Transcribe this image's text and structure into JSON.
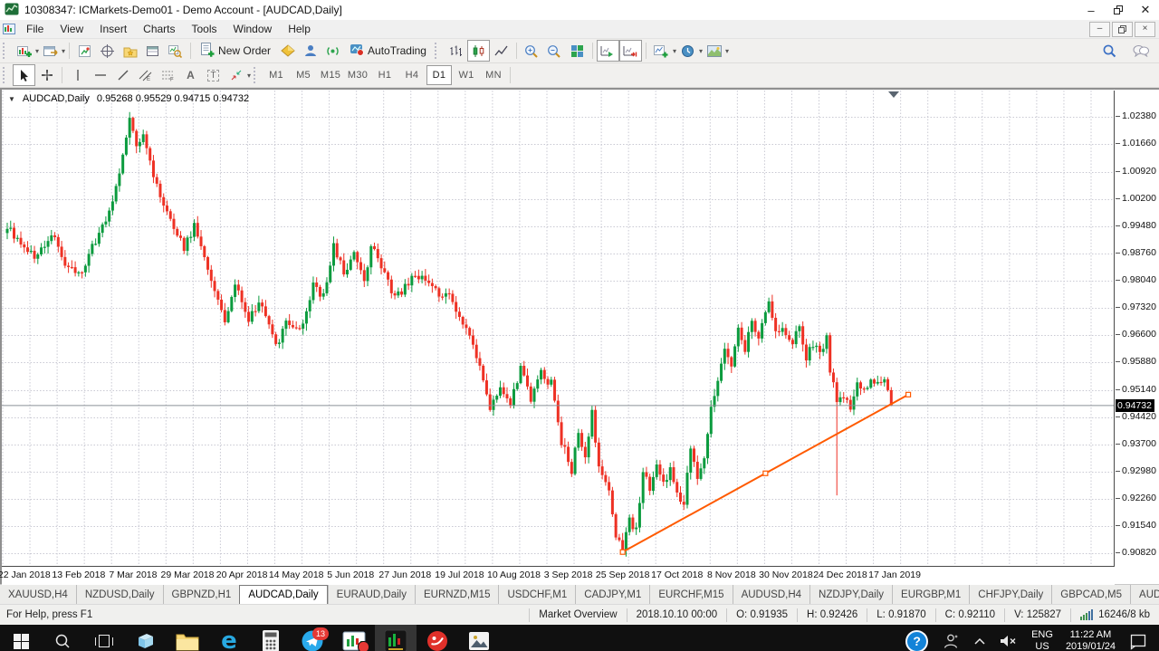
{
  "window": {
    "title": "10308347: ICMarkets-Demo01 - Demo Account - [AUDCAD,Daily]"
  },
  "menu": {
    "items": [
      "File",
      "View",
      "Insert",
      "Charts",
      "Tools",
      "Window",
      "Help"
    ]
  },
  "toolbar": {
    "new_order_label": "New Order",
    "autotrading_label": "AutoTrading",
    "timeframes": [
      "M1",
      "M5",
      "M15",
      "M30",
      "H1",
      "H4",
      "D1",
      "W1",
      "MN"
    ],
    "active_timeframe": "D1"
  },
  "chart": {
    "symbol_label": "AUDCAD,Daily",
    "ohlc_text": "0.95268 0.95529 0.94715 0.94732",
    "current_price": "0.94732",
    "price_axis_labels": [
      "1.02380",
      "1.01660",
      "1.00920",
      "1.00200",
      "0.99480",
      "0.98760",
      "0.98040",
      "0.97320",
      "0.96600",
      "0.95880",
      "0.95140",
      "0.94420",
      "0.93700",
      "0.92980",
      "0.92260",
      "0.91540",
      "0.90820"
    ],
    "date_axis_labels": [
      "22 Jan 2018",
      "13 Feb 2018",
      "7 Mar 2018",
      "29 Mar 2018",
      "20 Apr 2018",
      "14 May 2018",
      "5 Jun 2018",
      "27 Jun 2018",
      "19 Jul 2018",
      "10 Aug 2018",
      "3 Sep 2018",
      "25 Sep 2018",
      "17 Oct 2018",
      "8 Nov 2018",
      "30 Nov 2018",
      "24 Dec 2018",
      "17 Jan 2019"
    ]
  },
  "chart_data": {
    "type": "candlestick",
    "symbol": "AUDCAD",
    "timeframe": "Daily",
    "title": "AUDCAD,Daily",
    "y_axis": {
      "visible_min": 0.905,
      "visible_max": 1.031,
      "gridline_step": 0.0072,
      "labels_min": 0.9082,
      "labels_max": 1.0238
    },
    "x_axis": {
      "days_total": 261,
      "label_every_days": 16,
      "first_label": "22 Jan 2018",
      "last_label": "17 Jan 2019"
    },
    "current_bar": {
      "open": 0.95268,
      "high": 0.95529,
      "low": 0.94715,
      "close": 0.94732
    },
    "bid_line_price": 0.94732,
    "close_path_waypoints": [
      [
        0,
        0.9945
      ],
      [
        4,
        0.9905
      ],
      [
        8,
        0.9868
      ],
      [
        11,
        0.99
      ],
      [
        13,
        0.9925
      ],
      [
        17,
        0.9855
      ],
      [
        21,
        0.982
      ],
      [
        24,
        0.987
      ],
      [
        27,
        0.993
      ],
      [
        30,
        0.9985
      ],
      [
        33,
        1.008
      ],
      [
        36,
        1.0235
      ],
      [
        38,
        1.015
      ],
      [
        40,
        1.019
      ],
      [
        43,
        1.008
      ],
      [
        46,
        1.0005
      ],
      [
        49,
        0.995
      ],
      [
        52,
        0.989
      ],
      [
        55,
        0.9945
      ],
      [
        58,
        0.986
      ],
      [
        61,
        0.978
      ],
      [
        64,
        0.9705
      ],
      [
        67,
        0.979
      ],
      [
        71,
        0.9705
      ],
      [
        75,
        0.9745
      ],
      [
        79,
        0.9625
      ],
      [
        82,
        0.97
      ],
      [
        86,
        0.9665
      ],
      [
        90,
        0.979
      ],
      [
        93,
        0.976
      ],
      [
        96,
        0.9895
      ],
      [
        99,
        0.983
      ],
      [
        102,
        0.9868
      ],
      [
        105,
        0.98
      ],
      [
        107,
        0.99
      ],
      [
        110,
        0.9835
      ],
      [
        114,
        0.9755
      ],
      [
        118,
        0.98
      ],
      [
        122,
        0.9822
      ],
      [
        126,
        0.9772
      ],
      [
        130,
        0.977
      ],
      [
        133,
        0.9705
      ],
      [
        136,
        0.965
      ],
      [
        139,
        0.958
      ],
      [
        142,
        0.9455
      ],
      [
        145,
        0.953
      ],
      [
        148,
        0.948
      ],
      [
        151,
        0.9575
      ],
      [
        154,
        0.949
      ],
      [
        157,
        0.956
      ],
      [
        160,
        0.953
      ],
      [
        163,
        0.938
      ],
      [
        166,
        0.93
      ],
      [
        168,
        0.94
      ],
      [
        170,
        0.933
      ],
      [
        172,
        0.945
      ],
      [
        174,
        0.93
      ],
      [
        177,
        0.9245
      ],
      [
        179,
        0.913
      ],
      [
        181,
        0.91
      ],
      [
        183,
        0.9165
      ],
      [
        185,
        0.915
      ],
      [
        187,
        0.93
      ],
      [
        189,
        0.9245
      ],
      [
        191,
        0.932
      ],
      [
        193,
        0.927
      ],
      [
        195,
        0.9305
      ],
      [
        197,
        0.9235
      ],
      [
        199,
        0.9222
      ],
      [
        201,
        0.935
      ],
      [
        203,
        0.9285
      ],
      [
        205,
        0.934
      ],
      [
        207,
        0.947
      ],
      [
        209,
        0.9545
      ],
      [
        211,
        0.9628
      ],
      [
        213,
        0.9585
      ],
      [
        215,
        0.968
      ],
      [
        217,
        0.9625
      ],
      [
        219,
        0.969
      ],
      [
        221,
        0.9645
      ],
      [
        223,
        0.972
      ],
      [
        224,
        0.9738
      ],
      [
        226,
        0.966
      ],
      [
        228,
        0.9685
      ],
      [
        231,
        0.964
      ],
      [
        233,
        0.968
      ],
      [
        235,
        0.9602
      ],
      [
        237,
        0.964
      ],
      [
        239,
        0.9618
      ],
      [
        241,
        0.9648
      ],
      [
        242,
        0.956
      ],
      [
        244,
        0.949
      ],
      [
        246,
        0.9505
      ],
      [
        248,
        0.9472
      ],
      [
        250,
        0.954
      ],
      [
        252,
        0.9512
      ],
      [
        254,
        0.9552
      ],
      [
        256,
        0.9525
      ],
      [
        258,
        0.9545
      ],
      [
        259,
        0.9505
      ],
      [
        260,
        0.94732
      ]
    ],
    "spike": {
      "day": 244,
      "low": 0.9235
    },
    "trendline": {
      "from_day": 181,
      "from_price": 0.9085,
      "to_day": 265,
      "to_price": 0.9502,
      "color": "#ff5a00"
    },
    "colors": {
      "up": "#0b9b3e",
      "down": "#ee3124",
      "grid": "#c9c9d3",
      "bid_line": "#8a9096",
      "background": "#ffffff"
    }
  },
  "tabs": {
    "items": [
      "XAUUSD,H4",
      "NZDUSD,Daily",
      "GBPNZD,H1",
      "AUDCAD,Daily",
      "EURAUD,Daily",
      "EURNZD,M15",
      "USDCHF,M1",
      "CADJPY,M1",
      "EURCHF,M15",
      "AUDUSD,H4",
      "NZDJPY,Daily",
      "EURGBP,M1",
      "CHFJPY,Daily",
      "GBPCAD,M5",
      "AUDCHF"
    ],
    "active": "AUDCAD,Daily"
  },
  "status": {
    "help_text": "For Help, press F1",
    "segments": [
      "Market Overview",
      "2018.10.10 00:00",
      "O: 0.91935",
      "H: 0.92426",
      "L: 0.91870",
      "C: 0.92110",
      "V: 125827"
    ],
    "connection": "16246/8 kb"
  },
  "taskbar": {
    "telegram_badge": "13",
    "tray": {
      "lang_line1": "ENG",
      "lang_line2": "US",
      "time": "11:22 AM",
      "date": "2019/01/24"
    }
  }
}
